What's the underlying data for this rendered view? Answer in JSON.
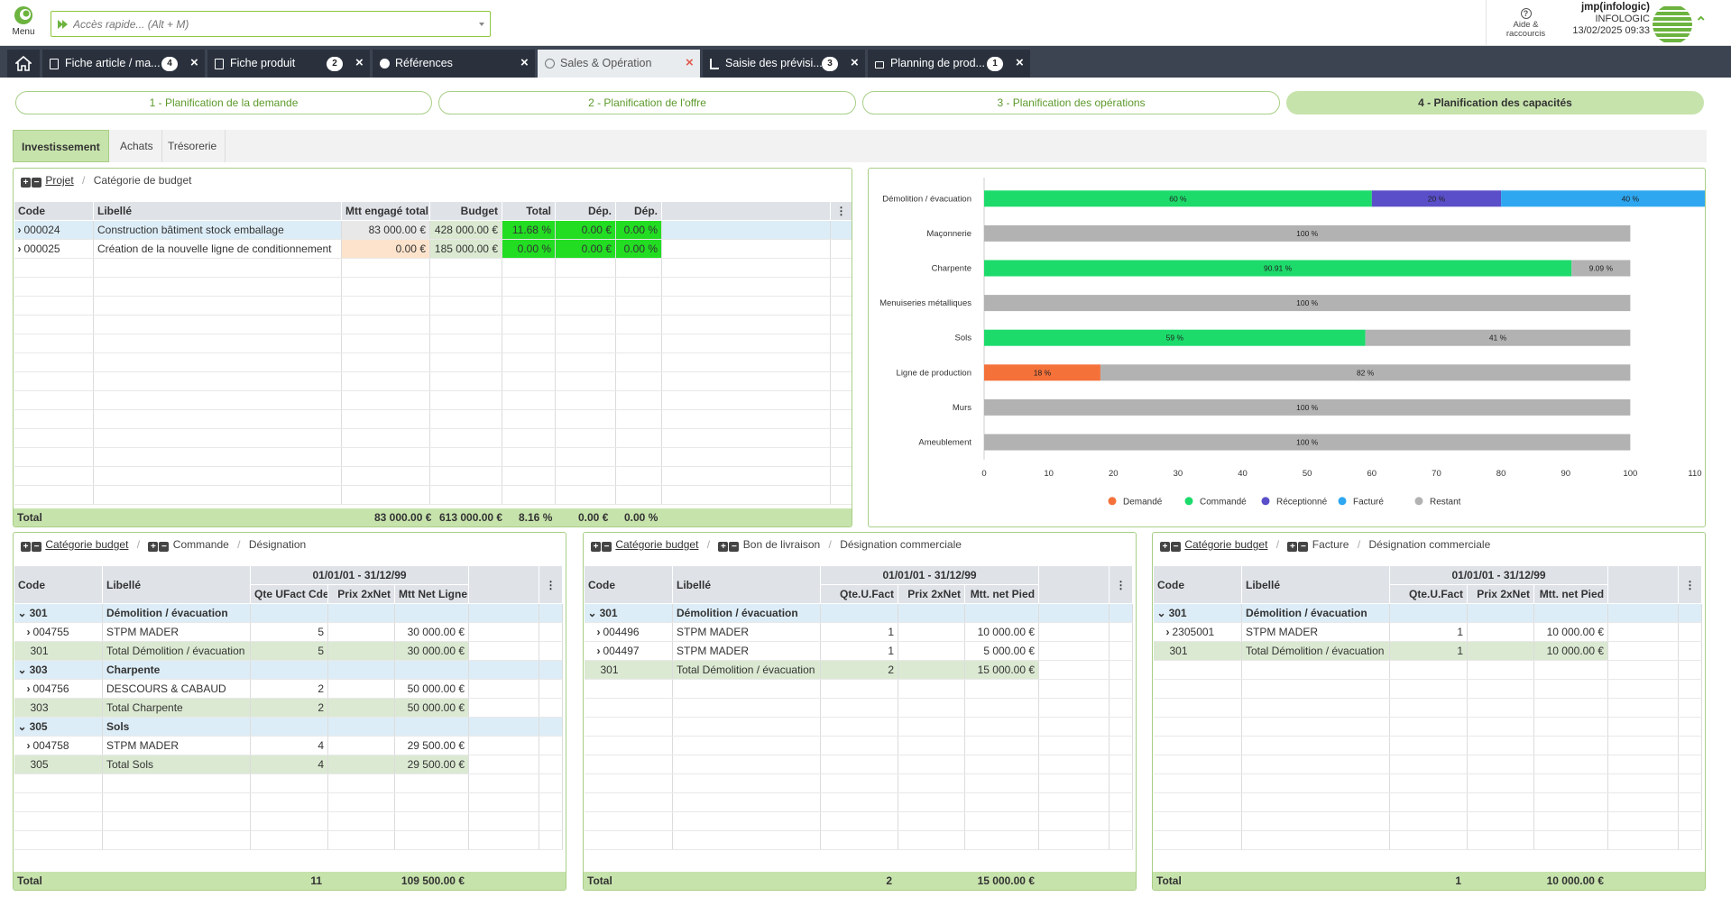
{
  "topbar": {
    "menu_label": "Menu",
    "quick_placeholder": "Accès rapide... (Alt + M)",
    "help_label_1": "Aide &",
    "help_label_2": "raccourcis",
    "user_name": "jmp(infologic)",
    "company": "INFOLOGIC",
    "datetime": "13/02/2025 09:33"
  },
  "tabs": [
    {
      "label": "Fiche article / ma...",
      "badge": "4"
    },
    {
      "label": "Fiche produit",
      "badge": "2"
    },
    {
      "label": "Références",
      "badge": ""
    },
    {
      "label": "Sales & Opération",
      "badge": ""
    },
    {
      "label": "Saisie des prévisi...",
      "badge": "3"
    },
    {
      "label": "Planning de prod...",
      "badge": "1"
    }
  ],
  "steps": [
    "1 - Planification de la demande",
    "2 - Planification de l'offre",
    "3 - Planification des opérations",
    "4 - Planification des capacités"
  ],
  "subtabs": [
    "Investissement",
    "Achats",
    "Trésorerie"
  ],
  "projects": {
    "crumb_project": "Projet",
    "crumb_category": "Catégorie de budget",
    "headers": [
      "Code",
      "Libellé",
      "Mtt engagé total",
      "Budget",
      "Total",
      "Dép.",
      "Dép."
    ],
    "rows": [
      {
        "code": "000024",
        "label": "Construction bâtiment stock emballage",
        "engaged": "83 000.00 €",
        "budget": "428 000.00 €",
        "total": "11.68 %",
        "dep1": "0.00 €",
        "dep2": "0.00 %"
      },
      {
        "code": "000025",
        "label": "Création de la nouvelle ligne de conditionnement",
        "engaged": "0.00 €",
        "budget": "185 000.00 €",
        "total": "0.00 %",
        "dep1": "0.00 €",
        "dep2": "0.00 %"
      }
    ],
    "total_label": "Total",
    "total_engaged": "83 000.00 €",
    "total_budget": "613 000.00 €",
    "total_pct": "8.16 %",
    "total_dep1": "0.00 €",
    "total_dep2": "0.00 %"
  },
  "chart_data": {
    "type": "bar",
    "orientation": "horizontal",
    "stacked": true,
    "categories": [
      "Démolition / évacuation",
      "Maçonnerie",
      "Charpente",
      "Menuiseries métalliques",
      "Sols",
      "Ligne de production",
      "Murs",
      "Ameublement"
    ],
    "series": [
      {
        "name": "Demandé",
        "color": "#f4713a",
        "values": [
          0,
          0,
          0,
          0,
          0,
          18,
          0,
          0
        ],
        "labels": [
          "",
          "",
          "",
          "",
          "",
          "18 %",
          "",
          ""
        ]
      },
      {
        "name": "Commandé",
        "color": "#1ddb6b",
        "values": [
          60,
          0,
          90.91,
          0,
          59,
          0,
          0,
          0
        ],
        "labels": [
          "60 %",
          "",
          "90.91 %",
          "",
          "59 %",
          "",
          "",
          ""
        ]
      },
      {
        "name": "Réceptionné",
        "color": "#5a4fc9",
        "values": [
          20,
          0,
          0,
          0,
          0,
          0,
          0,
          0
        ],
        "labels": [
          "20 %",
          "",
          "",
          "",
          "",
          "",
          "",
          ""
        ]
      },
      {
        "name": "Facturé",
        "color": "#2ea7f0",
        "values": [
          40,
          0,
          0,
          0,
          0,
          0,
          0,
          0
        ],
        "labels": [
          "40 %",
          "",
          "",
          "",
          "",
          "",
          "",
          ""
        ]
      },
      {
        "name": "Restant",
        "color": "#b2b2b2",
        "values": [
          0,
          100,
          9.09,
          100,
          41,
          82,
          100,
          100
        ],
        "labels": [
          "",
          "100 %",
          "9.09 %",
          "100 %",
          "41 %",
          "82 %",
          "100 %",
          "100 %"
        ]
      }
    ],
    "x_ticks": [
      "0",
      "10",
      "20",
      "30",
      "40",
      "50",
      "60",
      "70",
      "80",
      "90",
      "100",
      "110"
    ],
    "xlim": [
      0,
      110
    ],
    "legend_position": "bottom",
    "grid": false
  },
  "orders": {
    "crumb_category": "Catégorie budget",
    "crumb_order": "Commande",
    "crumb_designation": "Désignation",
    "period": "01/01/01 - 31/12/99",
    "headers": [
      "Code",
      "Libellé",
      "Qte UFact Cde",
      "Prix 2xNet",
      "Mtt Net Ligne"
    ],
    "rows": [
      {
        "type": "grp",
        "code": "301",
        "label": "Démolition / évacuation",
        "qty": "",
        "price": "",
        "amount": ""
      },
      {
        "type": "item",
        "code": "004755",
        "label": "STPM MADER",
        "qty": "5",
        "price": "",
        "amount": "30 000.00 €"
      },
      {
        "type": "sub",
        "code": "301",
        "label": "Total Démolition / évacuation",
        "qty": "5",
        "price": "",
        "amount": "30 000.00 €"
      },
      {
        "type": "grp",
        "code": "303",
        "label": "Charpente",
        "qty": "",
        "price": "",
        "amount": ""
      },
      {
        "type": "item",
        "code": "004756",
        "label": "DESCOURS & CABAUD",
        "qty": "2",
        "price": "",
        "amount": "50 000.00 €"
      },
      {
        "type": "sub",
        "code": "303",
        "label": "Total Charpente",
        "qty": "2",
        "price": "",
        "amount": "50 000.00 €"
      },
      {
        "type": "grp",
        "code": "305",
        "label": "Sols",
        "qty": "",
        "price": "",
        "amount": ""
      },
      {
        "type": "item",
        "code": "004758",
        "label": "STPM MADER",
        "qty": "4",
        "price": "",
        "amount": "29 500.00 €"
      },
      {
        "type": "sub",
        "code": "305",
        "label": "Total Sols",
        "qty": "4",
        "price": "",
        "amount": "29 500.00 €"
      }
    ],
    "total_label": "Total",
    "total_qty": "11",
    "total_amount": "109 500.00 €"
  },
  "deliveries": {
    "crumb_category": "Catégorie budget",
    "crumb_order": "Bon de livraison",
    "crumb_designation": "Désignation commerciale",
    "period": "01/01/01 - 31/12/99",
    "headers": [
      "Code",
      "Libellé",
      "Qte.U.Fact",
      "Prix 2xNet",
      "Mtt. net Pied"
    ],
    "rows": [
      {
        "type": "grp",
        "code": "301",
        "label": "Démolition / évacuation",
        "qty": "",
        "price": "",
        "amount": ""
      },
      {
        "type": "item",
        "code": "004496",
        "label": "STPM MADER",
        "qty": "1",
        "price": "",
        "amount": "10 000.00 €"
      },
      {
        "type": "item",
        "code": "004497",
        "label": "STPM MADER",
        "qty": "1",
        "price": "",
        "amount": "5 000.00 €"
      },
      {
        "type": "sub",
        "code": "301",
        "label": "Total Démolition / évacuation",
        "qty": "2",
        "price": "",
        "amount": "15 000.00 €"
      }
    ],
    "total_label": "Total",
    "total_qty": "2",
    "total_amount": "15 000.00 €"
  },
  "invoices": {
    "crumb_category": "Catégorie budget",
    "crumb_order": "Facture",
    "crumb_designation": "Désignation commerciale",
    "period": "01/01/01 - 31/12/99",
    "headers": [
      "Code",
      "Libellé",
      "Qte.U.Fact",
      "Prix 2xNet",
      "Mtt. net Pied"
    ],
    "rows": [
      {
        "type": "grp",
        "code": "301",
        "label": "Démolition / évacuation",
        "qty": "",
        "price": "",
        "amount": ""
      },
      {
        "type": "item",
        "code": "2305001",
        "label": "STPM MADER",
        "qty": "1",
        "price": "",
        "amount": "10 000.00 €"
      },
      {
        "type": "sub",
        "code": "301",
        "label": "Total Démolition / évacuation",
        "qty": "1",
        "price": "",
        "amount": "10 000.00 €"
      }
    ],
    "total_label": "Total",
    "total_qty": "1",
    "total_amount": "10 000.00 €"
  },
  "colors": {
    "accent": "#8dc63f",
    "active_step": "#c7e3ac",
    "tabbar": "#3c4452"
  }
}
